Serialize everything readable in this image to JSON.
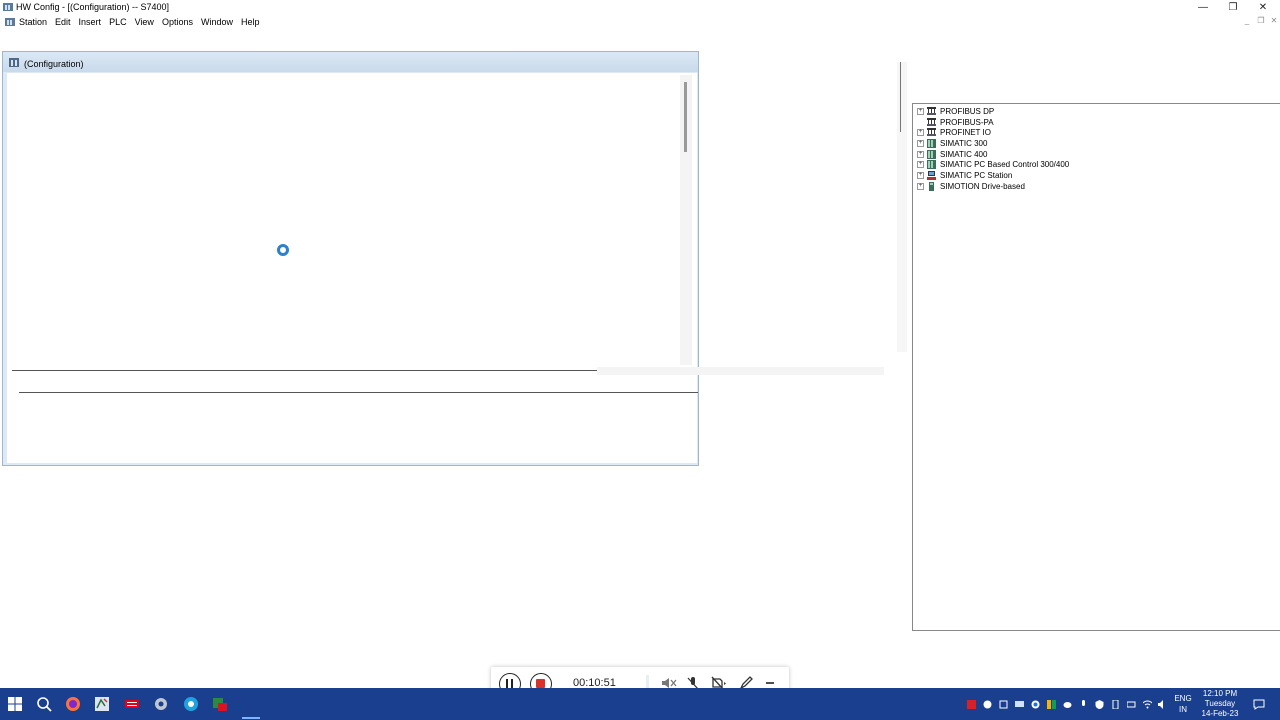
{
  "window": {
    "title": "HW Config - [(Configuration) -- S7400]",
    "minimize_glyph": "—",
    "maximize_glyph": "❐",
    "close_glyph": "✕"
  },
  "menubar": {
    "items": [
      "Station",
      "Edit",
      "Insert",
      "PLC",
      "View",
      "Options",
      "Window",
      "Help"
    ],
    "mdi_minimize": "_",
    "mdi_restore": "❐",
    "mdi_close": "✕"
  },
  "config_window": {
    "title": "(Configuration)"
  },
  "catalog": {
    "items": [
      {
        "label": "PROFIBUS DP",
        "expandable": true,
        "icon": "network-icon"
      },
      {
        "label": "PROFIBUS-PA",
        "expandable": false,
        "icon": "network-icon"
      },
      {
        "label": "PROFINET IO",
        "expandable": true,
        "icon": "network-icon"
      },
      {
        "label": "SIMATIC 300",
        "expandable": true,
        "icon": "rack-icon"
      },
      {
        "label": "SIMATIC 400",
        "expandable": true,
        "icon": "rack-icon"
      },
      {
        "label": "SIMATIC PC Based Control 300/400",
        "expandable": true,
        "icon": "rack-icon"
      },
      {
        "label": "SIMATIC PC Station",
        "expandable": true,
        "icon": "pc-station-icon"
      },
      {
        "label": "SIMOTION Drive-based",
        "expandable": true,
        "icon": "drive-icon"
      }
    ]
  },
  "recorder": {
    "timer": "00:10:51"
  },
  "taskbar": {
    "lang_top": "ENG",
    "lang_bottom": "IN",
    "time": "12:10 PM",
    "day": "Tuesday",
    "date": "14-Feb-23"
  },
  "colors": {
    "taskbar": "#1a3f8f",
    "caption": "#c9daec",
    "spinner": "#2c7fd1",
    "stop": "#d9322b"
  }
}
